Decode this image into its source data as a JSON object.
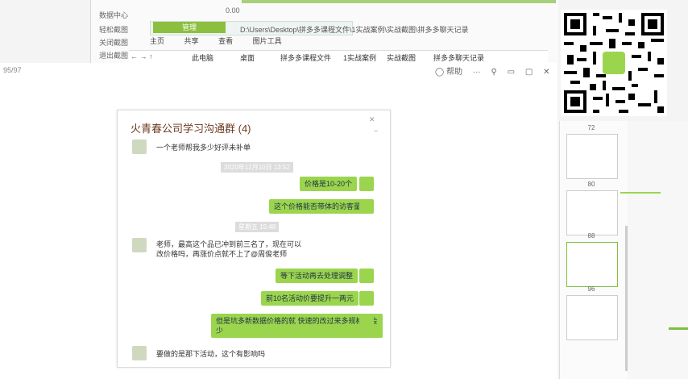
{
  "background_window": {
    "toolbar_label": "数据中心",
    "progress_value": "0.00",
    "row2_label": "轻松截图",
    "row3_label": "关闭截图",
    "row4_label": "退出截图",
    "ribbon_tab": "管理",
    "path": "D:\\Users\\Desktop\\拼多多课程文件\\1实战案例\\实战截图\\拼多多聊天记录",
    "tabs": [
      "主页",
      "共享",
      "查看",
      "图片工具"
    ],
    "breadcrumbs": [
      "此电脑",
      "桌面",
      "拼多多课程文件",
      "1实战案例",
      "实战截图",
      "拼多多聊天记录"
    ]
  },
  "viewer": {
    "page_counter": "95/97",
    "title_buttons": [
      "◯ 帮助",
      "···",
      "⚲",
      "▭",
      "▢",
      "✕"
    ]
  },
  "chat": {
    "title": "火青春公司学习沟通群 (4)",
    "messages": [
      {
        "side": "left",
        "text": "一个老师帮我多少好评未补单"
      },
      {
        "side": "time",
        "text": "2020年12月10日 13:52"
      },
      {
        "side": "right",
        "text": "价格是10-20个"
      },
      {
        "side": "right",
        "text": "这个价格能否带体的访客量的"
      },
      {
        "side": "time",
        "text": "星期五 15:48"
      },
      {
        "side": "left",
        "text": "老师，最高这个品已冲到前三名了，现在可以\n改价格吗，再涨价点就不上了@周俊老师"
      },
      {
        "side": "right",
        "text": "等下活动再去处理调整"
      },
      {
        "side": "right",
        "text": "前10名活动价要提升一两元"
      },
      {
        "side": "right",
        "text": "但是坑多新数据价格的就  快速的改过来多规格就会\n少"
      },
      {
        "side": "left",
        "text": "要做的是那下活动，这个有影响吗"
      }
    ]
  },
  "thumbnails": {
    "labels": [
      "72",
      "80",
      "88",
      "96"
    ]
  },
  "colors": {
    "accent": "#8cbf3f",
    "bubble": "#9bd54e",
    "title": "#6b3a1f"
  }
}
